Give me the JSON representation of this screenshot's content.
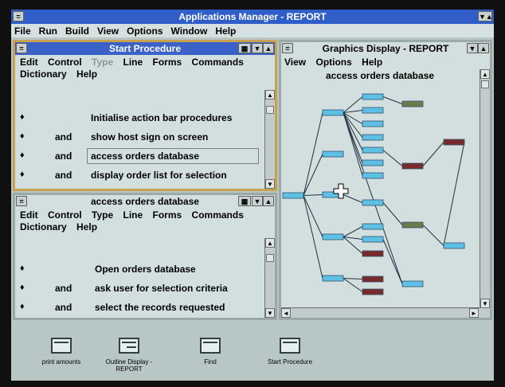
{
  "app": {
    "title": "Applications Manager - REPORT",
    "menu": [
      "File",
      "Run",
      "Build",
      "View",
      "Options",
      "Window",
      "Help"
    ],
    "sys_left": "=",
    "sys_right": "▼▲"
  },
  "start_window": {
    "title": "Start Procedure",
    "menu_row1": [
      "Edit",
      "Control",
      "Type",
      "Line",
      "Forms",
      "Commands"
    ],
    "menu_row2": [
      "Dictionary",
      "Help"
    ],
    "lines": [
      {
        "bullet": "♦",
        "conn": "",
        "text": "Initialise action bar procedures"
      },
      {
        "bullet": "♦",
        "conn": "and",
        "text": "show host sign on screen"
      },
      {
        "bullet": "♦",
        "conn": "and",
        "text": "access orders database"
      },
      {
        "bullet": "♦",
        "conn": "and",
        "text": "display order list for selection"
      }
    ]
  },
  "access_window": {
    "title": "access orders database",
    "menu_row1": [
      "Edit",
      "Control",
      "Type",
      "Line",
      "Forms",
      "Commands"
    ],
    "menu_row2": [
      "Dictionary",
      "Help"
    ],
    "lines": [
      {
        "bullet": "♦",
        "conn": "",
        "text": "Open orders database"
      },
      {
        "bullet": "♦",
        "conn": "and",
        "text": "ask user for selection criteria"
      },
      {
        "bullet": "♦",
        "conn": "and",
        "text": "select the records requested"
      }
    ]
  },
  "graphics_window": {
    "title": "Graphics Display - REPORT",
    "menu": [
      "View",
      "Options",
      "Help"
    ],
    "subtitle": "access orders database",
    "colors": {
      "node": "#5ec0e4",
      "node_dark": "#7a2a2a",
      "node_olive": "#6a7a4a",
      "edge": "#203040"
    }
  },
  "desktop_icons": [
    {
      "label": "print amounts"
    },
    {
      "label": "Outline Display - REPORT"
    },
    {
      "label": "Find"
    },
    {
      "label": "Start Procedure"
    }
  ]
}
